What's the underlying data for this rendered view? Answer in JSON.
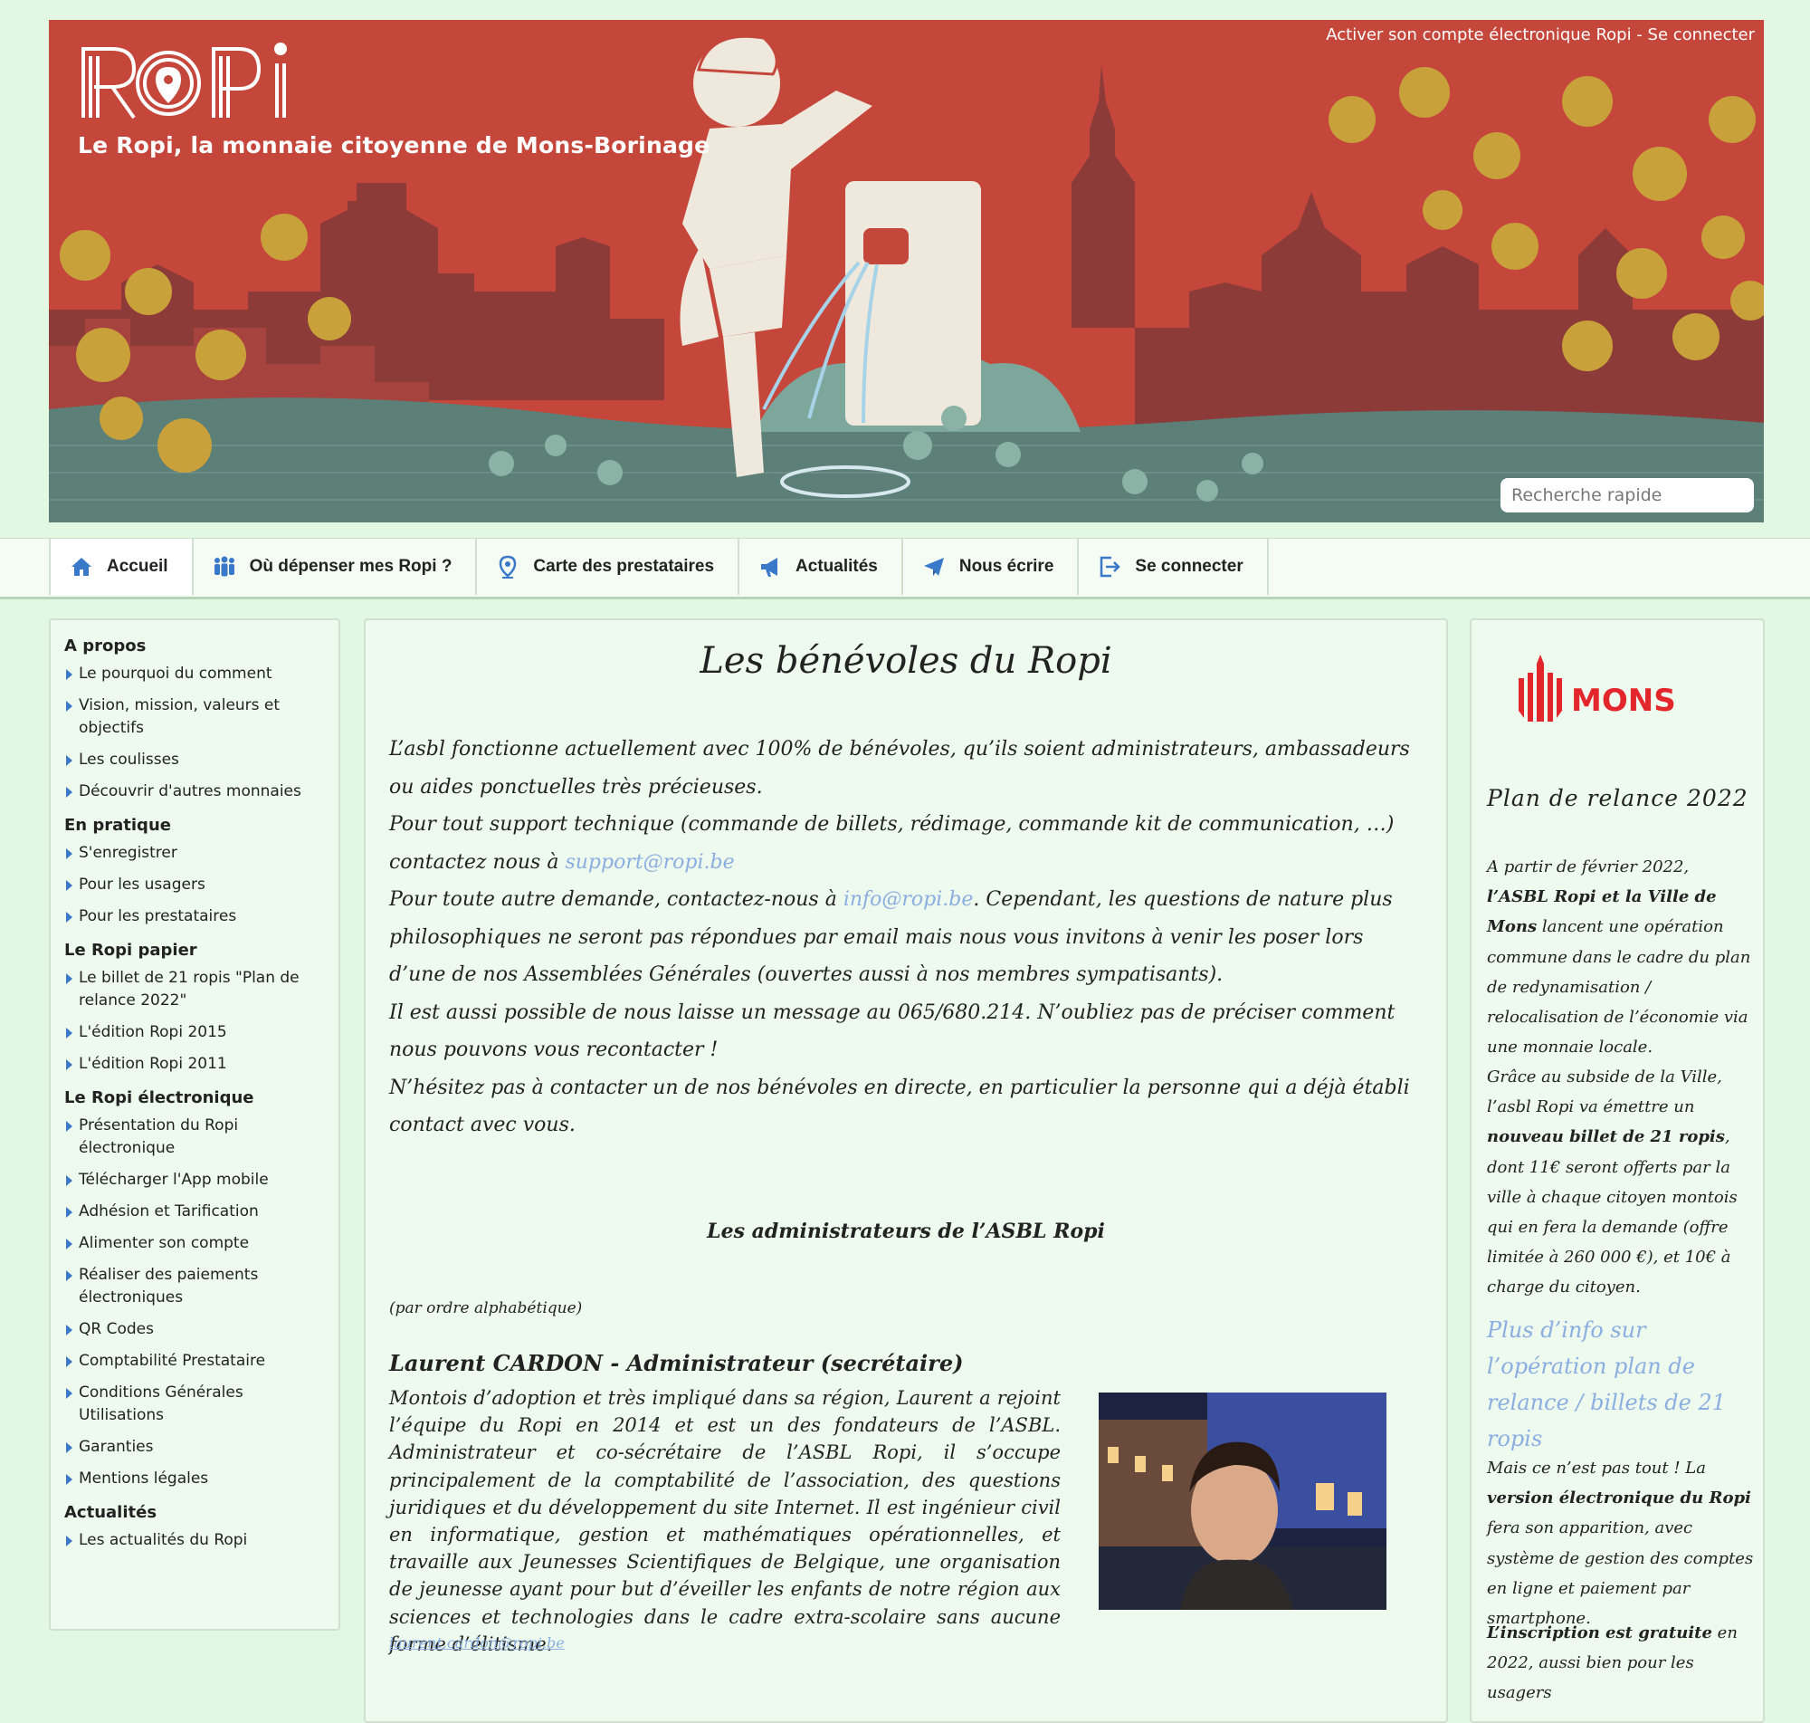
{
  "header": {
    "tagline": "Le Ropi, la monnaie citoyenne de Mons-Borinage",
    "logo_text": "ROPI",
    "activate_link": "Activer son compte électronique Ropi",
    "separator": " - ",
    "login_link": "Se connecter",
    "search_placeholder": "Recherche rapide"
  },
  "nav": {
    "items": [
      {
        "label": "Accueil",
        "icon": "home-icon"
      },
      {
        "label": "Où dépenser mes Ropi ?",
        "icon": "people-icon"
      },
      {
        "label": "Carte des prestataires",
        "icon": "map-pin-icon"
      },
      {
        "label": "Actualités",
        "icon": "megaphone-icon"
      },
      {
        "label": "Nous écrire",
        "icon": "paper-plane-icon"
      },
      {
        "label": "Se connecter",
        "icon": "sign-in-icon"
      }
    ]
  },
  "sidebar": {
    "sections": [
      {
        "title": "A propos",
        "items": [
          "Le pourquoi du comment",
          "Vision, mission, valeurs et objectifs",
          "Les coulisses",
          "Découvrir d'autres monnaies"
        ]
      },
      {
        "title": "En pratique",
        "items": [
          "S'enregistrer",
          "Pour les usagers",
          "Pour les prestataires"
        ]
      },
      {
        "title": "Le Ropi papier",
        "items": [
          "Le billet de 21 ropis \"Plan de relance 2022\"",
          "L'édition Ropi 2015",
          "L'édition Ropi 2011"
        ]
      },
      {
        "title": "Le Ropi électronique",
        "items": [
          "Présentation du Ropi électronique",
          "Télécharger l'App mobile",
          "Adhésion et Tarification",
          "Alimenter son compte",
          "Réaliser des paiements électroniques",
          "QR Codes",
          "Comptabilité Prestataire",
          "Conditions Générales Utilisations",
          "Garanties",
          "Mentions légales"
        ]
      },
      {
        "title": "Actualités",
        "items": [
          "Les actualités du Ropi"
        ]
      }
    ]
  },
  "main": {
    "title": "Les bénévoles du Ropi",
    "p1": "L’asbl fonctionne actuellement avec 100% de bénévoles, qu’ils soient administrateurs, ambassadeurs ou aides ponctuelles très précieuses.",
    "p2_before": "Pour tout support technique (commande de billets, rédimage, commande kit de communication, …) contactez nous à ",
    "p2_link": "support@ropi.be",
    "p3_before": "Pour toute autre demande, contactez-nous à ",
    "p3_link": "info@ropi.be",
    "p3_after": ". Cependant, les questions de nature plus philosophiques ne seront pas répondues par email mais nous vous invitons à venir les poser lors d’une de nos Assemblées Générales (ouvertes aussi à nos membres sympatisants).",
    "p4": "Il est aussi possible de nous laisse un message au 065/680.214. N’oubliez pas de préciser comment nous pouvons vous recontacter !",
    "p5": "N’hésitez pas à contacter un de nos bénévoles en directe, en particulier la personne qui a déjà établi contact avec vous.",
    "admins_heading": "Les administrateurs de l’ASBL Ropi",
    "order_note": "(par ordre alphabétique)",
    "person": {
      "name": "Laurent CARDON - Administrateur (secrétaire)",
      "bio": "Montois d’adoption et très impliqué dans sa région, Laurent a rejoint l’équipe du Ropi en 2014 et est un des fondateurs de l’ASBL. Administrateur et co-sécrétaire de l’ASBL Ropi, il s’occupe principalement de la comptabilité de l’association, des questions juridiques et du développement du site Internet. Il est ingénieur civil en informatique, gestion et mathématiques opérationnelles, et travaille aux Jeunesses Scientifiques de Belgique, une organisation de jeunesse ayant pour but d’éveiller les enfants de notre région aux sciences et technologies dans le cadre extra-scolaire sans aucune forme d’élitisme.",
      "email": "laurent.cardon@ropi.be"
    }
  },
  "right": {
    "logo_text": "MONS",
    "title": "Plan de relance 2022",
    "p1_a": "A partir de février 2022, ",
    "p1_b": "l’ASBL Ropi et la Ville de Mons",
    "p1_c": " lancent une opération commune dans  le cadre du plan de redynamisation / relocalisation de l’économie via une monnaie locale.",
    "p2_a": "Grâce au subside de la Ville, l’asbl Ropi va émettre un ",
    "p2_b": "nouveau billet de 21 ropis",
    "p2_c": ", dont 11€ seront offerts par la ville à chaque citoyen montois qui en fera la demande (offre limitée à 260 000 €), et 10€ à charge du citoyen.",
    "link": "Plus d’info sur l’opération plan de relance / billets de 21 ropis",
    "p3_a": "Mais ce n’est pas tout ! La ",
    "p3_b": "version électronique du Ropi",
    "p3_c": " fera son apparition, avec système de gestion des comptes en ligne et paiement par smartphone.",
    "p4_a": "L’inscription est gratuite",
    "p4_b": " en 2022, aussi bien pour les usagers"
  },
  "colors": {
    "banner": "#c5463a",
    "page_bg": "#e3f8e3",
    "link": "#8aaee0",
    "nav_icon": "#3a78c9",
    "mons_red": "#e3262b"
  }
}
